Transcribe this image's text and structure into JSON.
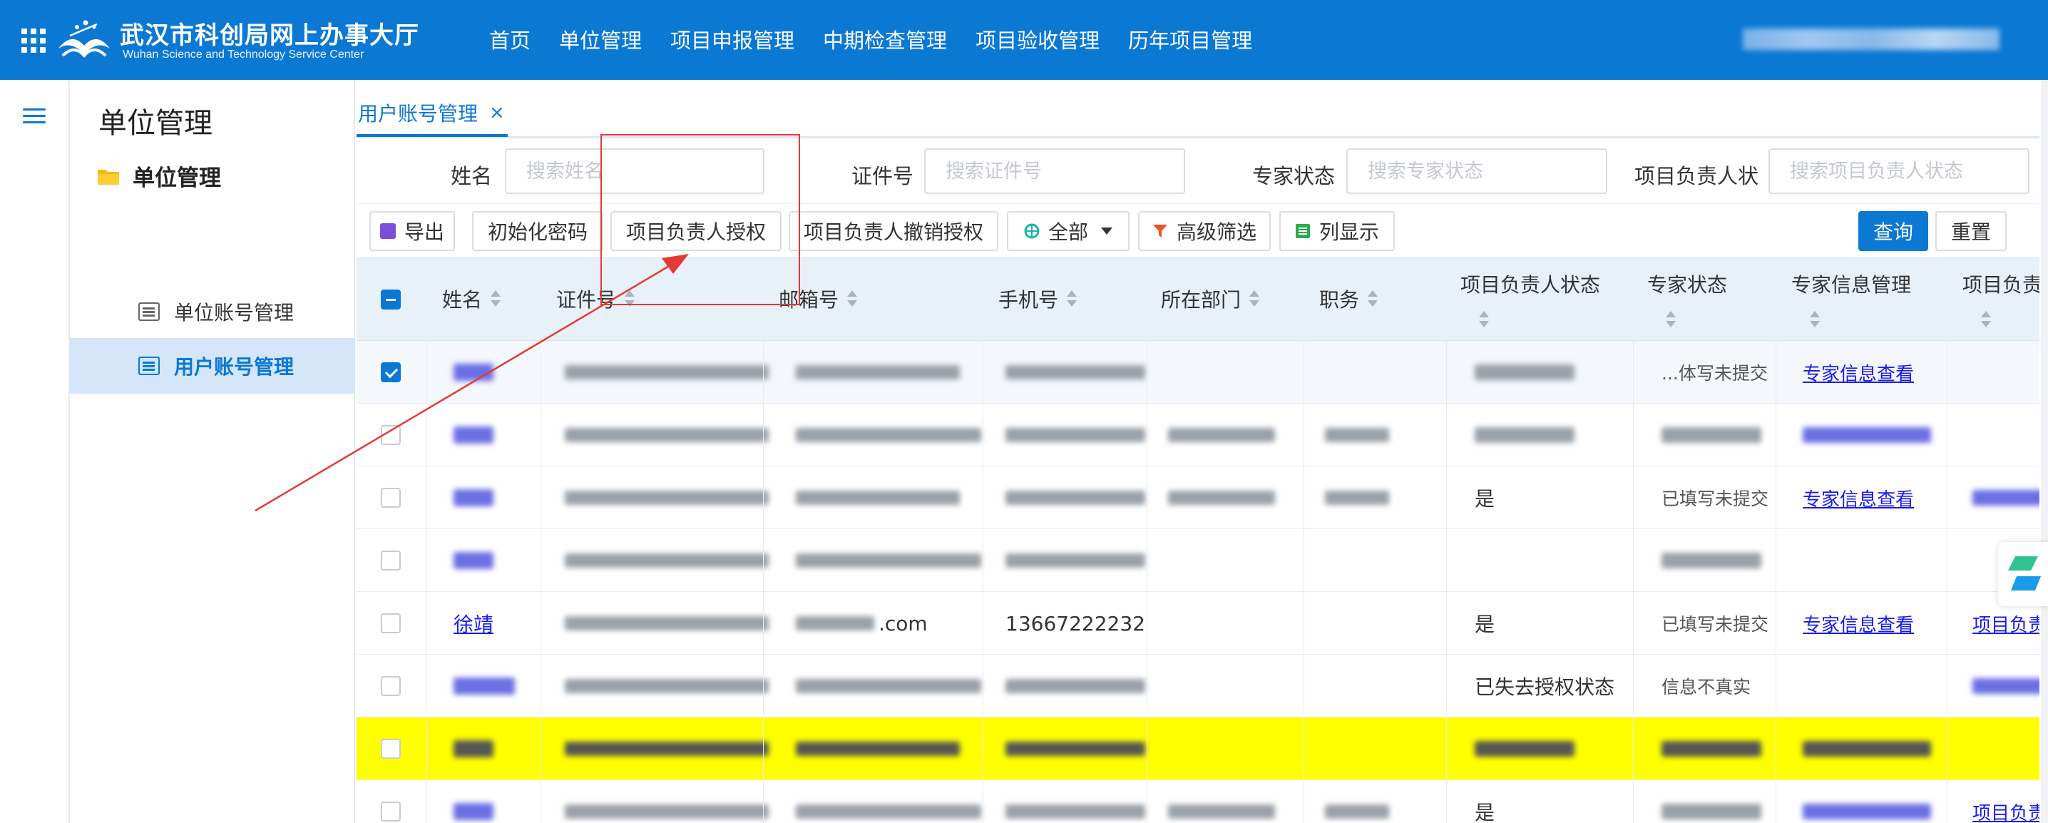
{
  "header": {
    "brand_cn": "武汉市科创局网上办事大厅",
    "brand_en": "Wuhan Science and Technology Service Center",
    "nav": [
      "首页",
      "单位管理",
      "项目申报管理",
      "中期检查管理",
      "项目验收管理",
      "历年项目管理"
    ],
    "icons": [
      "apps-grid-icon",
      "logo-icon"
    ]
  },
  "sidebar": {
    "title": "单位管理",
    "group": "单位管理",
    "items": [
      {
        "label": "单位账号管理",
        "active": false
      },
      {
        "label": "用户账号管理",
        "active": true
      }
    ]
  },
  "tabs": [
    {
      "label": "用户账号管理",
      "close": "×"
    }
  ],
  "search": {
    "name_label": "姓名",
    "name_placeholder": "搜索姓名",
    "id_label": "证件号",
    "id_placeholder": "搜索证件号",
    "expert_label": "专家状态",
    "expert_placeholder": "搜索专家状态",
    "leader_label": "项目负责人状",
    "leader_placeholder": "搜索项目负责人状态"
  },
  "toolbar": {
    "export": "导出",
    "reset_pwd": "初始化密码",
    "grant": "项目负责人授权",
    "revoke": "项目负责人撤销授权",
    "filter_all": "全部",
    "advanced": "高级筛选",
    "columns": "列显示",
    "query": "查询",
    "reset": "重置"
  },
  "table": {
    "headers": [
      "姓名",
      "证件号",
      "邮箱号",
      "手机号",
      "所在部门",
      "职务",
      "项目负责人状态",
      "专家状态",
      "专家信息管理",
      "项目负责"
    ],
    "rows": [
      {
        "checked": true,
        "highlight": false,
        "email": "",
        "phone": "",
        "leader": "",
        "expert": "...体写未提交",
        "info": "专家信息查看",
        "pm": ""
      },
      {
        "checked": false,
        "highlight": false,
        "email": "",
        "phone": "",
        "leader": "",
        "expert": "",
        "info": "",
        "pm": ""
      },
      {
        "checked": false,
        "highlight": false,
        "email": "",
        "phone": "",
        "leader": "是",
        "expert": "已填写未提交",
        "info": "专家信息查看",
        "pm": ""
      },
      {
        "checked": false,
        "highlight": false,
        "email": "",
        "phone": "",
        "leader": "",
        "expert": "",
        "info": "",
        "pm": ""
      },
      {
        "checked": false,
        "highlight": false,
        "name": "徐靖",
        "email": ".com",
        "phone": "13667222232",
        "leader": "是",
        "expert": "已填写未提交",
        "info": "专家信息查看",
        "pm": "项目负责"
      },
      {
        "checked": false,
        "highlight": false,
        "email": "",
        "phone": "",
        "leader": "已失去授权状态",
        "expert": "信息不真实",
        "info": "",
        "pm": ""
      },
      {
        "checked": false,
        "highlight": true,
        "email": "",
        "phone": "",
        "leader": "",
        "expert": "",
        "info": "",
        "pm": ""
      },
      {
        "checked": false,
        "highlight": false,
        "email": "",
        "phone": "",
        "leader": "是",
        "expert": "",
        "info": "",
        "pm": "项目负责"
      }
    ]
  },
  "colors": {
    "primary": "#0b78d3",
    "highlight_row": "#ffff00",
    "annotation": "#e53935"
  }
}
